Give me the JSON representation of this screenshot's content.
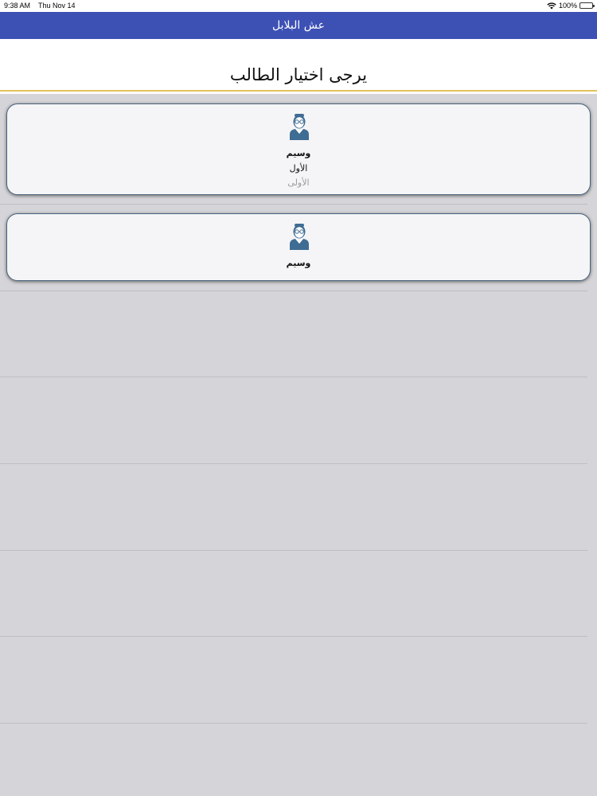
{
  "status": {
    "time": "9:38 AM",
    "date": "Thu Nov 14",
    "battery": "100%"
  },
  "nav": {
    "title": "عش البلابل"
  },
  "page": {
    "heading": "يرجى اختيار الطالب"
  },
  "students": [
    {
      "name": "وسيم",
      "line2": "الأول",
      "line3": "الأولى"
    },
    {
      "name": "وسيم"
    }
  ],
  "colors": {
    "nav_bg": "#3d51b5",
    "accent_line": "#e2c35a",
    "avatar": "#3f6c93"
  }
}
